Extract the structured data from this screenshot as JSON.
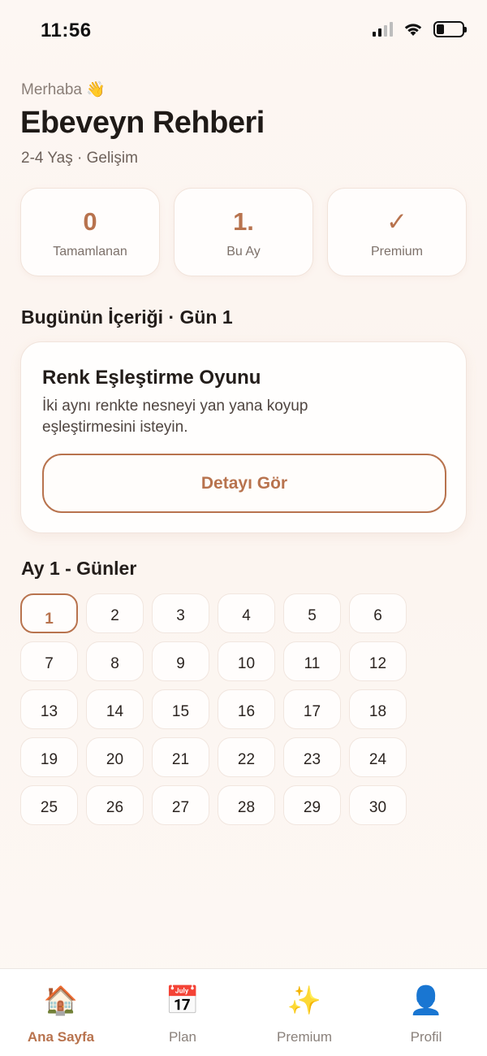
{
  "status": {
    "time": "11:56"
  },
  "header": {
    "greeting": "Merhaba 👋",
    "title": "Ebeveyn Rehberi",
    "subtitle": "2-4 Yaş · Gelişim"
  },
  "stats": [
    {
      "value": "0",
      "label": "Tamamlanan"
    },
    {
      "value": "1.",
      "label": "Bu Ay"
    },
    {
      "value": "✓",
      "label": "Premium"
    }
  ],
  "today": {
    "section_title": "Bugünün İçeriği · Gün 1",
    "card_title": "Renk Eşleştirme Oyunu",
    "card_description": "İki aynı renkte nesneyi yan yana koyup eşleştirmesini isteyin.",
    "button_label": "Detayı Gör"
  },
  "days": {
    "section_title": "Ay 1 - Günler",
    "selected": 1,
    "items": [
      "1",
      "2",
      "3",
      "4",
      "5",
      "6",
      "7",
      "8",
      "9",
      "10",
      "11",
      "12",
      "13",
      "14",
      "15",
      "16",
      "17",
      "18",
      "19",
      "20",
      "21",
      "22",
      "23",
      "24",
      "25",
      "26",
      "27",
      "28",
      "29",
      "30"
    ]
  },
  "tab_bar": {
    "active": "Ana Sayfa",
    "tabs": [
      {
        "label": "Ana Sayfa",
        "icon": "house-icon",
        "glyph": "🏠"
      },
      {
        "label": "Plan",
        "icon": "calendar-icon",
        "glyph": "📅"
      },
      {
        "label": "Premium",
        "icon": "sparkles-icon",
        "glyph": "✨"
      },
      {
        "label": "Profil",
        "icon": "person-icon",
        "glyph": "👤"
      }
    ]
  },
  "colors": {
    "accent": "#b8734e",
    "background": "#fdf7f3"
  }
}
